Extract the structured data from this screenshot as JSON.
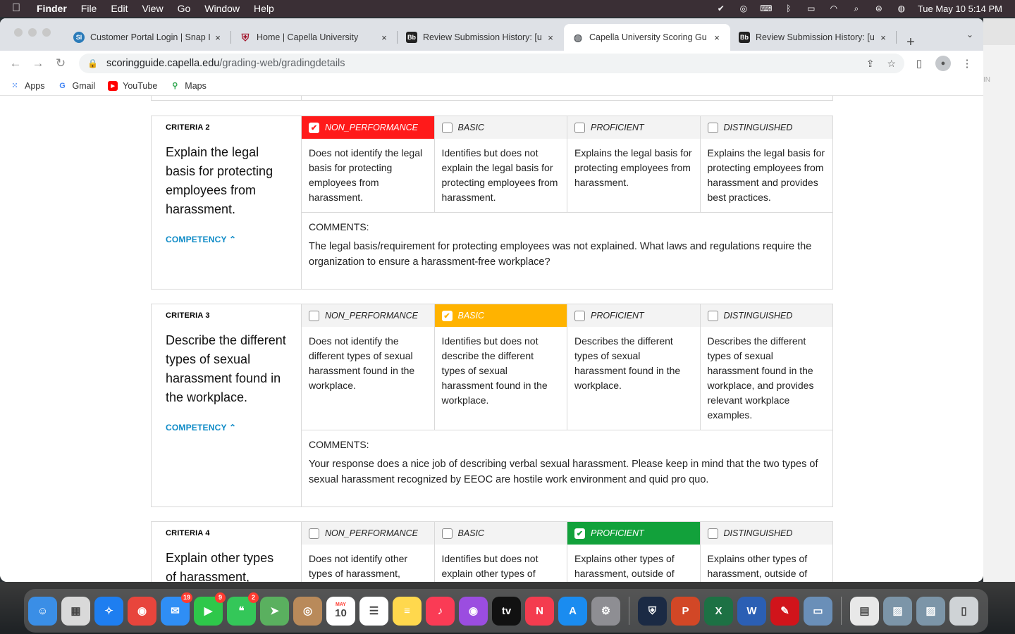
{
  "menubar": {
    "app": "Finder",
    "items": [
      "File",
      "Edit",
      "View",
      "Go",
      "Window",
      "Help"
    ],
    "datetime": "Tue May 10  5:14 PM"
  },
  "browser": {
    "tabs": [
      {
        "title": "Customer Portal Login | Snap I",
        "favicon": "SI",
        "color": "#2b7bb9",
        "active": false
      },
      {
        "title": "Home | Capella University",
        "favicon": "shield",
        "color": "#a3162c",
        "active": false
      },
      {
        "title": "Review Submission History: [u",
        "favicon": "Bb",
        "color": "#222222",
        "active": false
      },
      {
        "title": "Capella University Scoring Gu",
        "favicon": "globe",
        "color": "#5f6368",
        "active": true
      },
      {
        "title": "Review Submission History: [u",
        "favicon": "Bb",
        "color": "#222222",
        "active": false
      }
    ],
    "url_domain": "scoringguide.capella.edu",
    "url_path": "/grading-web/gradingdetails",
    "bookmarks": [
      {
        "label": "Apps",
        "icon": "apps-grid-icon"
      },
      {
        "label": "Gmail",
        "icon": "google-icon"
      },
      {
        "label": "YouTube",
        "icon": "youtube-icon"
      },
      {
        "label": "Maps",
        "icon": "maps-icon"
      }
    ],
    "side_text": "IN"
  },
  "levels": [
    "NON_PERFORMANCE",
    "BASIC",
    "PROFICIENT",
    "DISTINGUISHED"
  ],
  "competency_label": "COMPETENCY",
  "comments_label": "COMMENTS:",
  "criteria": [
    {
      "label": "CRITERIA 2",
      "description": "Explain the legal basis for protecting employees from harassment.",
      "selected": "NON_PERFORMANCE",
      "level_texts": [
        "Does not identify the legal basis for protecting employees from harassment.",
        "Identifies but does not explain the legal basis for protecting employees from harassment.",
        "Explains the legal basis for protecting employees from harassment.",
        "Explains the legal basis for protecting employees from harassment and provides best practices."
      ],
      "comment": "The legal basis/requirement for protecting employees was not explained. What laws and regulations require the organization to ensure a harassment-free workplace?"
    },
    {
      "label": "CRITERIA 3",
      "description": "Describe the different types of sexual harassment found in the workplace.",
      "selected": "BASIC",
      "level_texts": [
        "Does not identify the different types of sexual harassment found in the workplace.",
        "Identifies but does not describe the different types of sexual harassment found in the workplace.",
        "Describes the different types of sexual harassment found in the workplace.",
        "Describes the different types of sexual harassment found in the workplace, and provides relevant workplace examples."
      ],
      "comment": "Your response does a nice job of describing verbal sexual harassment. Please keep in mind that the two types of sexual harassment recognized by EEOC are hostile work environment and quid pro quo."
    },
    {
      "label": "CRITERIA 4",
      "description": "Explain other types of harassment,",
      "selected": "PROFICIENT",
      "level_texts": [
        "Does not identify other types of harassment,",
        "Identifies but does not explain other types of",
        "Explains other types of harassment, outside of",
        "Explains other types of harassment, outside of"
      ],
      "comment": ""
    }
  ],
  "colors": {
    "non_performance": "#ff1a1a",
    "basic": "#ffb300",
    "proficient": "#12a13b",
    "competency_link": "#0d8ac6"
  },
  "dock": [
    {
      "name": "finder",
      "color": "#3a8ee6",
      "glyph": "☺"
    },
    {
      "name": "launchpad",
      "color": "#d9d9d9",
      "glyph": "▦"
    },
    {
      "name": "safari",
      "color": "#1e7ef0",
      "glyph": "✧"
    },
    {
      "name": "chrome",
      "color": "#e8453c",
      "glyph": "◉"
    },
    {
      "name": "mail",
      "color": "#2f8ef5",
      "glyph": "✉",
      "badge": "19"
    },
    {
      "name": "facetime",
      "color": "#2ec84a",
      "glyph": "▶",
      "badge": "9"
    },
    {
      "name": "messages",
      "color": "#34c759",
      "glyph": "❝",
      "badge": "2"
    },
    {
      "name": "maps",
      "color": "#5ab05f",
      "glyph": "➤"
    },
    {
      "name": "contacts",
      "color": "#b98a5a",
      "glyph": "◎"
    },
    {
      "name": "calendar",
      "color": "#ffffff",
      "glyph": "10",
      "sub": "MAY"
    },
    {
      "name": "reminders",
      "color": "#ffffff",
      "glyph": "☰"
    },
    {
      "name": "notes",
      "color": "#ffd84d",
      "glyph": "≡"
    },
    {
      "name": "music",
      "color": "#fa3b55",
      "glyph": "♪"
    },
    {
      "name": "podcasts",
      "color": "#9b4de0",
      "glyph": "◉"
    },
    {
      "name": "tv",
      "color": "#111111",
      "glyph": "tv"
    },
    {
      "name": "news",
      "color": "#f43c4f",
      "glyph": "N"
    },
    {
      "name": "app-store",
      "color": "#1a8cf0",
      "glyph": "A"
    },
    {
      "name": "system-preferences",
      "color": "#8e8e93",
      "glyph": "⚙"
    },
    {
      "name": "security-app",
      "color": "#1b2a44",
      "glyph": "⛨"
    },
    {
      "name": "powerpoint",
      "color": "#d24726",
      "glyph": "P"
    },
    {
      "name": "excel",
      "color": "#1d7144",
      "glyph": "X"
    },
    {
      "name": "word",
      "color": "#2b5fb4",
      "glyph": "W"
    },
    {
      "name": "acrobat",
      "color": "#d1141b",
      "glyph": "✎"
    },
    {
      "name": "preview",
      "color": "#6a8fb8",
      "glyph": "▭"
    },
    {
      "name": "document",
      "color": "#e8e8e8",
      "glyph": "▤"
    },
    {
      "name": "screenshot-1",
      "color": "#7c95a8",
      "glyph": "▨"
    },
    {
      "name": "screenshot-2",
      "color": "#7c95a8",
      "glyph": "▨"
    },
    {
      "name": "trash",
      "color": "#cfd3d6",
      "glyph": "▯"
    }
  ]
}
